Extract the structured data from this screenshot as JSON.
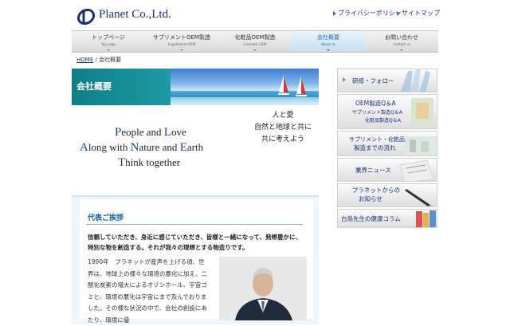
{
  "header": {
    "logo_text": "Planet Co.,Ltd.",
    "links": [
      "プライバシーポリシー",
      "サイトマップ"
    ],
    "accent": "#1c2f6e"
  },
  "nav": {
    "items": [
      {
        "jp": "トップページ",
        "en": "Top page"
      },
      {
        "jp": "サプリメントOEM製造",
        "en": "Supplement OEM"
      },
      {
        "jp": "化粧品OEM製造",
        "en": "Cosmetic OEM"
      },
      {
        "jp": "会社概要",
        "en": "About Us"
      },
      {
        "jp": "お問い合わせ",
        "en": "Contact us"
      }
    ],
    "active_index": 3
  },
  "breadcrumb": {
    "home": "HOME",
    "separator": "/",
    "current": "会社概要"
  },
  "banner": {
    "title": "会社概要"
  },
  "tagline": {
    "en": [
      {
        "cap1": "P",
        "rest1": "eople and ",
        "cap2": "L",
        "rest2": "ove"
      },
      {
        "cap1": "A",
        "rest1": "long with ",
        "cap2": "N",
        "rest2": "ature and ",
        "cap3": "E",
        "rest3": "arth"
      },
      {
        "cap1": "T",
        "rest1": "hink together"
      }
    ],
    "jp": [
      "人と愛",
      "自然と地球と共に",
      "共に考えよう"
    ]
  },
  "greeting": {
    "title": "代表ご挨拶",
    "lead": "信頼していただき、身近に感じていただき、皆様と一緒になって、発想豊かに、特別な物を創造する。それが我々の理想とする物造りです。",
    "body": "1990年　プラネットが産声を上げる頃、世界は、地球上の様々な環境の悪化に加え、二酸化炭素の増大によるオゾンホール、宇宙ゴミと、環境の悪化は宇宙にまで及んでおりました。その様な状況の中で、会社の創設にあたり、環境に優"
  },
  "sidebar": {
    "items": [
      {
        "lines": [
          "研修・フォロー"
        ],
        "icon": "hands-icon"
      },
      {
        "lines": [
          "OEM製造Q＆A",
          "サプリメント製造Q＆A",
          "化粧品製造Q＆A"
        ],
        "icon": "qa-icon"
      },
      {
        "lines": [
          "サプリメント・化粧品",
          "製造までの流れ"
        ],
        "icon": "factory-icon"
      },
      {
        "lines": [
          "業界ニュース"
        ],
        "icon": "newspaper-icon"
      },
      {
        "lines": [
          "プラネットからの",
          "お知らせ"
        ],
        "icon": "pen-icon"
      },
      {
        "lines": [
          "白鳥先生の健康コラム"
        ],
        "icon": "books-icon"
      }
    ]
  }
}
